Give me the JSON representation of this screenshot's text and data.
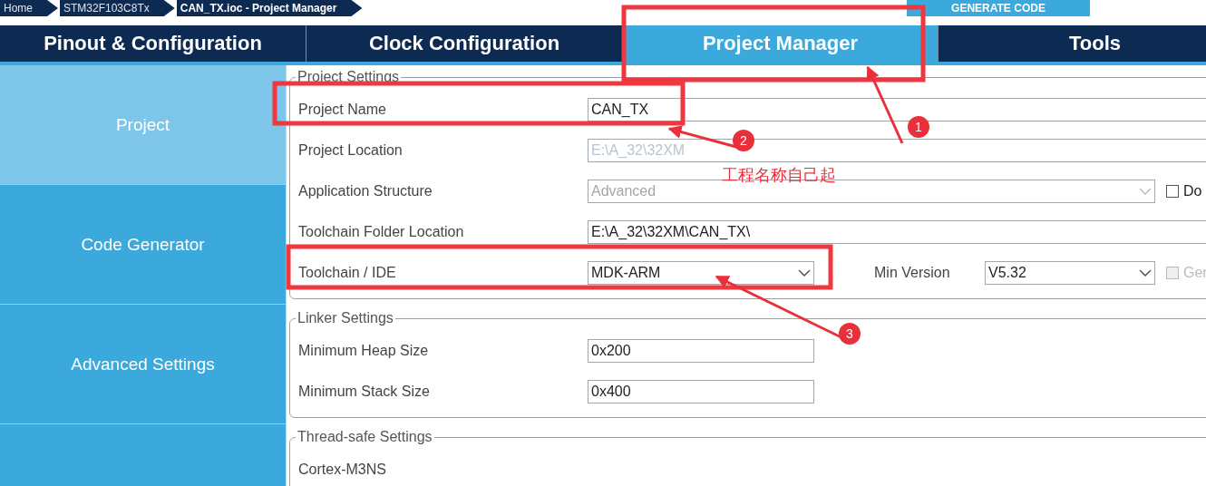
{
  "breadcrumb": {
    "items": [
      {
        "label": "Home",
        "current": false
      },
      {
        "label": "STM32F103C8Tx",
        "current": false
      },
      {
        "label": "CAN_TX.ioc - Project Manager",
        "current": true
      }
    ],
    "action": "GENERATE CODE"
  },
  "tabs": [
    {
      "label": "Pinout & Configuration",
      "selected": false
    },
    {
      "label": "Clock Configuration",
      "selected": false
    },
    {
      "label": "Project Manager",
      "selected": true
    },
    {
      "label": "Tools",
      "selected": false
    }
  ],
  "sidebar": {
    "items": [
      {
        "label": "Project",
        "selected": true
      },
      {
        "label": "Code Generator",
        "selected": false
      },
      {
        "label": "Advanced Settings",
        "selected": false
      },
      {
        "selected": false
      }
    ]
  },
  "sections": [
    {
      "title": "Project Settings",
      "rows": [
        {
          "label": "Project Name",
          "kind": "text",
          "value": "CAN_TX",
          "disabled": false
        },
        {
          "label": "Project Location",
          "kind": "text",
          "value": "E:\\A_32\\32XM",
          "disabled": true
        },
        {
          "label": "Application Structure",
          "kind": "select",
          "value": "Advanced",
          "disabled": true,
          "checkbox": {
            "label": "Do",
            "checked": false,
            "disabled": false
          }
        },
        {
          "label": "Toolchain Folder Location",
          "kind": "text",
          "value": "E:\\A_32\\32XM\\CAN_TX\\",
          "disabled": false
        },
        {
          "label": "Toolchain / IDE",
          "kind": "select",
          "value": "MDK-ARM",
          "disabled": false,
          "extra": {
            "label": "Min Version",
            "value": "V5.32"
          },
          "checkbox": {
            "label": "Ger",
            "checked": false,
            "disabled": true
          }
        }
      ]
    },
    {
      "title": "Linker Settings",
      "rows": [
        {
          "label": "Minimum Heap Size",
          "kind": "short",
          "value": "0x200",
          "disabled": false
        },
        {
          "label": "Minimum Stack Size",
          "kind": "short",
          "value": "0x400",
          "disabled": false
        }
      ]
    },
    {
      "title": "Thread-safe Settings",
      "rows": [
        {
          "label": "Cortex-M3NS",
          "kind": "plain"
        }
      ]
    }
  ],
  "annotations": [
    {
      "marker": "1"
    },
    {
      "marker": "2",
      "note": "工程名称自己起"
    },
    {
      "marker": "3"
    }
  ]
}
